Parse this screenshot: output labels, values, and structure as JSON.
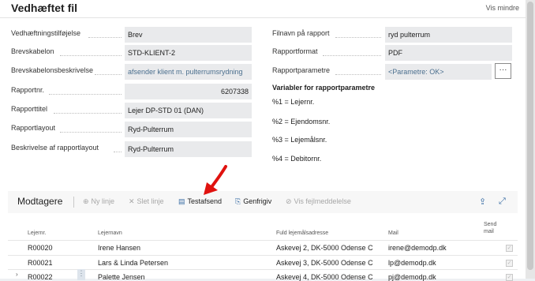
{
  "header": {
    "title": "Vedhæftet fil",
    "show_less": "Vis mindre"
  },
  "left_fields": [
    {
      "label": "Vedhæftningstilføjelse",
      "value": "Brev"
    },
    {
      "label": "Brevskabelon",
      "value": "STD-KLIENT-2"
    },
    {
      "label": "Brevskabelonsbeskrivelse",
      "value": "afsender klient m. pulterrumsrydning"
    },
    {
      "label": "Rapportnr.",
      "value": "6207338"
    },
    {
      "label": "Rapporttitel",
      "value": "Lejer DP-STD 01 (DAN)"
    },
    {
      "label": "Rapportlayout",
      "value": "Ryd-Pulterrum"
    },
    {
      "label": "Beskrivelse af rapportlayout",
      "value": "Ryd-Pulterrum"
    }
  ],
  "right_fields": [
    {
      "label": "Filnavn på rapport",
      "value": "ryd pulterrum"
    },
    {
      "label": "Rapportformat",
      "value": "PDF"
    },
    {
      "label": "Rapportparametre",
      "value": "<Parametre: OK>"
    }
  ],
  "assist_button": "···",
  "variables": {
    "title": "Variabler for rapportparametre",
    "lines": [
      "%1 = Lejernr.",
      "%2 = Ejendomsnr.",
      "%3 = Lejemålsnr.",
      "%4 = Debitornr."
    ]
  },
  "recipients": {
    "title": "Modtagere",
    "toolbar": [
      {
        "label": "Ny linje",
        "icon": "new-line-icon",
        "glyph": "⊕",
        "enabled": false
      },
      {
        "label": "Slet linje",
        "icon": "delete-line-icon",
        "glyph": "✕",
        "enabled": false
      },
      {
        "label": "Testafsend",
        "icon": "test-send-icon",
        "glyph": "▤",
        "enabled": true
      },
      {
        "label": "Genfrigiv",
        "icon": "release-icon",
        "glyph": "⎘",
        "enabled": true
      },
      {
        "label": "Vis fejlmeddelelse",
        "icon": "show-error-icon",
        "glyph": "⊘",
        "enabled": false
      }
    ],
    "columns": {
      "lejernr": "Lejernr.",
      "lejernavn": "Lejernavn",
      "adresse": "Fuld lejemålsadresse",
      "mail": "Mail",
      "send_line1": "Send",
      "send_line2": "mail"
    },
    "rows": [
      {
        "lejernr": "R00020",
        "lejernavn": "Irene Hansen",
        "adresse": "Askevej 2, DK-5000 Odense C",
        "mail": "irene@demodp.dk",
        "send": true
      },
      {
        "lejernr": "R00021",
        "lejernavn": "Lars & Linda Petersen",
        "adresse": "Askevej 3, DK-5000 Odense C",
        "mail": "lp@demodp.dk",
        "send": true
      },
      {
        "lejernr": "R00022",
        "lejernavn": "Palette Jensen",
        "adresse": "Askevej 4, DK-5000 Odense C",
        "mail": "pj@demodp.dk",
        "send": true
      }
    ]
  },
  "colors": {
    "accent": "#3a6ea5",
    "field_bg": "#e9eaec",
    "link": "#4b6f8e",
    "annotation": "#e0120f"
  }
}
